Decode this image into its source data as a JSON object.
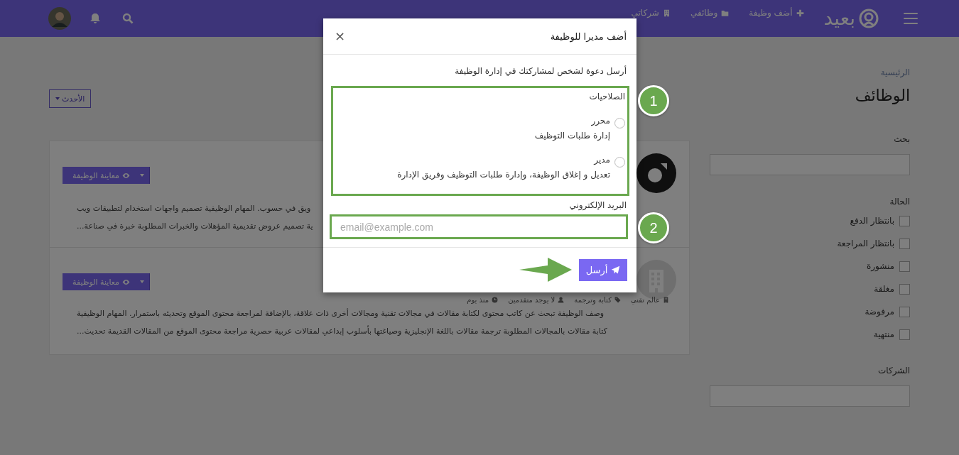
{
  "nav": {
    "brand": "بعيد",
    "links": [
      {
        "label": "أضف وظيفة"
      },
      {
        "label": "وظائفي"
      },
      {
        "label": "شركاتي"
      }
    ]
  },
  "breadcrumb": "الرئيسية",
  "page_title": "الوظائف",
  "sort": {
    "label": "الأحدث"
  },
  "jobs": [
    {
      "preview": "معاينة الوظيفة",
      "description": [
        "ويق في حسوب. المهام الوظيفية تصميم واجهات استخدام لتطبيقات ويب",
        "ية تصميم عروض تقديمية المؤهلات والخبرات المطلوبة خبرة في صناعة..."
      ]
    },
    {
      "preview": "معاينة الوظيفة",
      "meta": [
        {
          "text": "عالم تقني"
        },
        {
          "text": "كتابة وترجمة"
        },
        {
          "text": "لا يوجد متقدمين"
        },
        {
          "text": "منذ يوم"
        }
      ],
      "description": [
        "وصف الوظيفة تبحث عن كاتب محتوى لكتابة مقالات في مجالات تقنية ومجالات أخرى ذات علاقة، بالإضافة لمراجعة محتوى الموقع وتحديثه باستمرار. المهام الوظيفية",
        "كتابة مقالات بالمجالات المطلوبة ترجمة مقالات باللغة الإنجليزية وصياغتها بأسلوب إبداعي لمقالات عربية حصرية مراجعة محتوى الموقع من المقالات القديمة تحديث..."
      ]
    }
  ],
  "filters": {
    "search_label": "بحث",
    "status_label": "الحالة",
    "statuses": [
      {
        "label": "بانتظار الدفع",
        "checked": false
      },
      {
        "label": "بانتظار المراجعة",
        "checked": false
      },
      {
        "label": "منشورة",
        "checked": false
      },
      {
        "label": "مغلقة",
        "checked": false
      },
      {
        "label": "مرفوضة",
        "checked": false
      },
      {
        "label": "منتهية",
        "checked": false
      }
    ],
    "companies_label": "الشركات"
  },
  "modal": {
    "title": "أضف مديرا للوظيفة",
    "close": "×",
    "intro": "أرسل دعوة لشخص لمشاركتك في إدارة الوظيفة",
    "permissions_label": "الصلاحيات",
    "roles": [
      {
        "name": "محرر",
        "description": "إدارة طلبات التوظيف",
        "selected": false
      },
      {
        "name": "مدير",
        "description": "تعديل و إغلاق الوظيفة، وإدارة طلبات التوظيف وفريق الإدارة",
        "selected": false
      }
    ],
    "email_label": "البريد الإلكتروني",
    "email_placeholder": "email@example.com",
    "send": "أرسل"
  },
  "annotations": [
    {
      "label": "1"
    },
    {
      "label": "2"
    }
  ]
}
